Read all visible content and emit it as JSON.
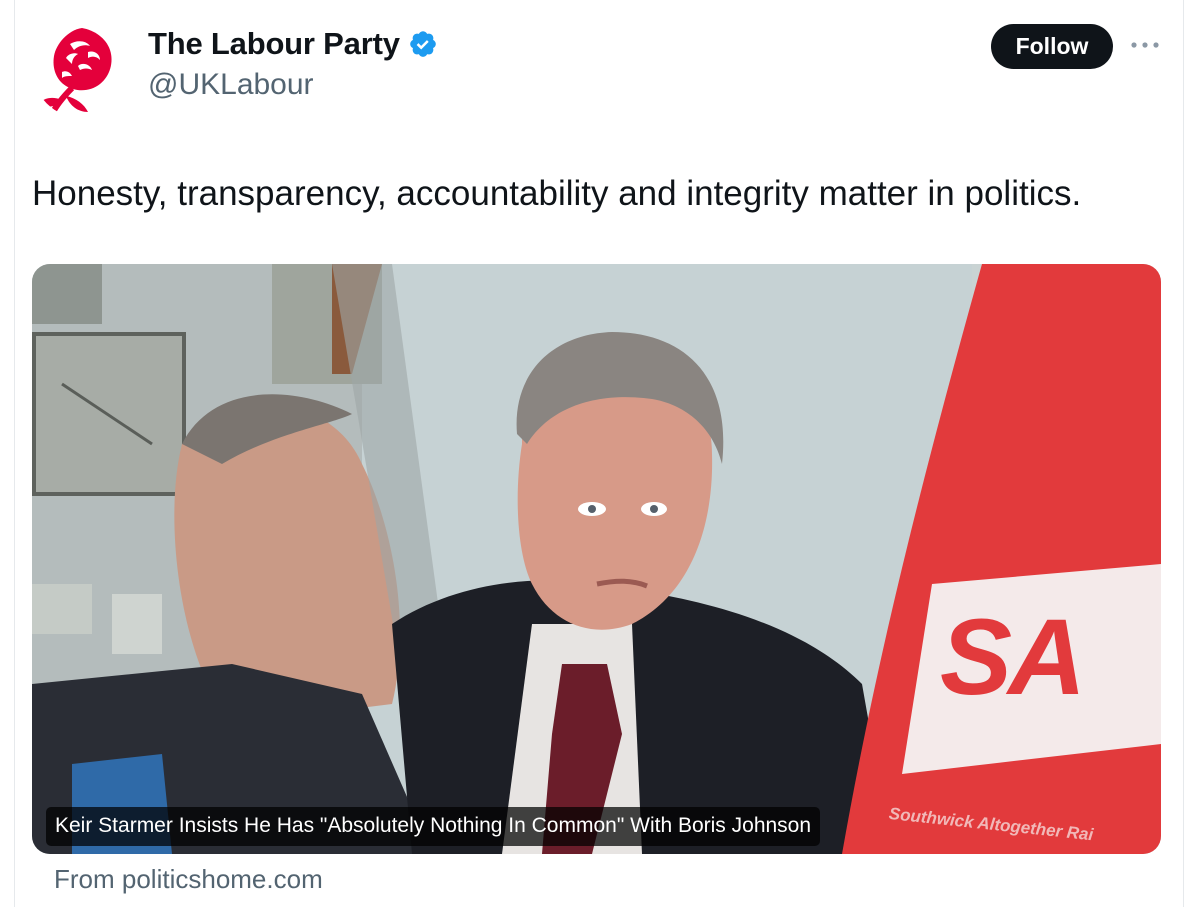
{
  "author": {
    "display_name": "The Labour Party",
    "handle": "@UKLabour",
    "avatar_icon": "labour-rose-icon",
    "verified_icon": "verified-badge-icon",
    "verified_color": "#1d9bf0"
  },
  "actions": {
    "follow_label": "Follow",
    "more_icon": "more-options-icon"
  },
  "tweet": {
    "text": "Honesty, transparency, accountability and integrity matter in politics."
  },
  "link_card": {
    "headline": "Keir Starmer Insists He Has \"Absolutely Nothing In Common\" With Boris Johnson",
    "banner_text": "SA",
    "banner_subtext": "Southwick Altogether Rai",
    "source": "From politicshome.com"
  },
  "colors": {
    "brand_red": "#e4003b",
    "banner_red": "#e23a3c"
  }
}
